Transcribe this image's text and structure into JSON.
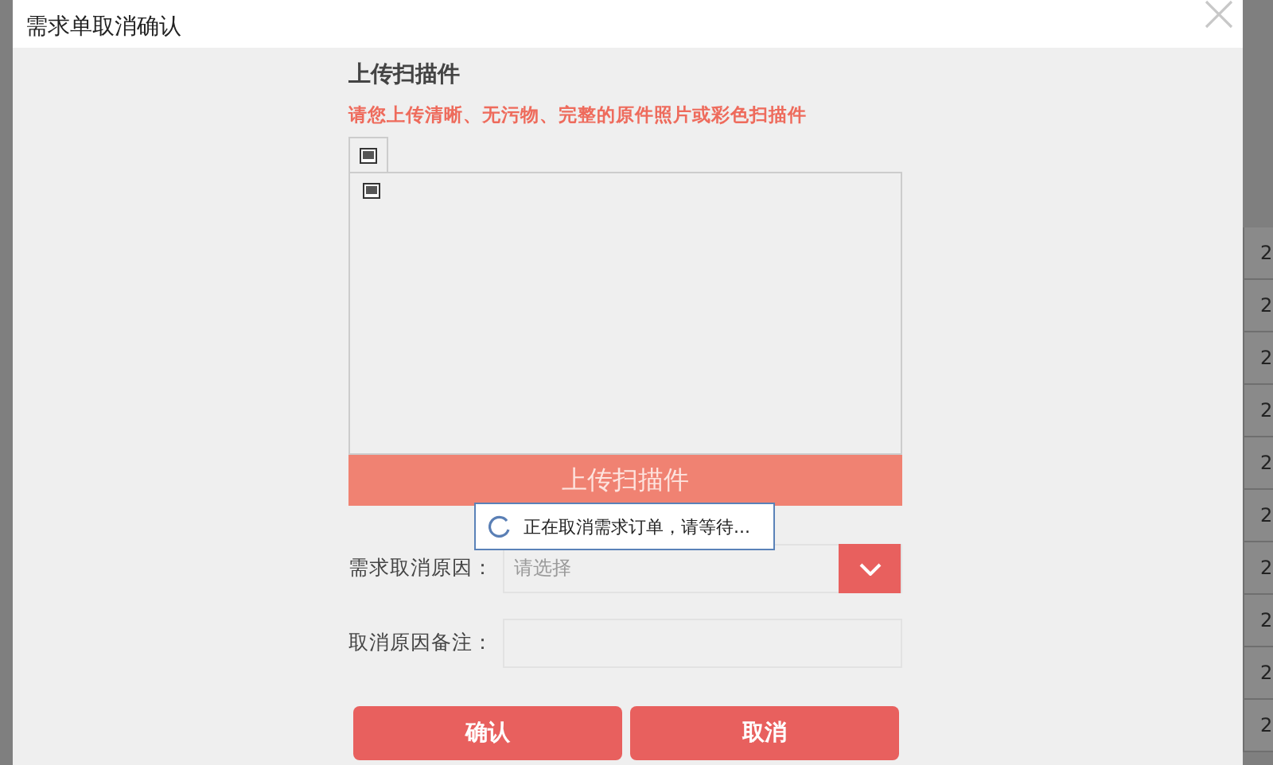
{
  "window": {
    "title": "需求单取消确认"
  },
  "upload": {
    "heading": "上传扫描件",
    "note": "请您上传清晰、无污物、完整的原件照片或彩色扫描件",
    "button": "上传扫描件"
  },
  "loading": {
    "message": "正在取消需求订单，请等待..."
  },
  "form": [
    {
      "kind": "select",
      "label": "需求取消原因：",
      "placeholder": "请选择"
    },
    {
      "kind": "text",
      "label": "取消原因备注："
    }
  ],
  "buttons": [
    "确认",
    "取消"
  ],
  "background_table": {
    "column_1": [
      "2",
      "2",
      "2",
      "2",
      "2",
      "2",
      "2",
      "2",
      "2",
      "2"
    ]
  }
}
